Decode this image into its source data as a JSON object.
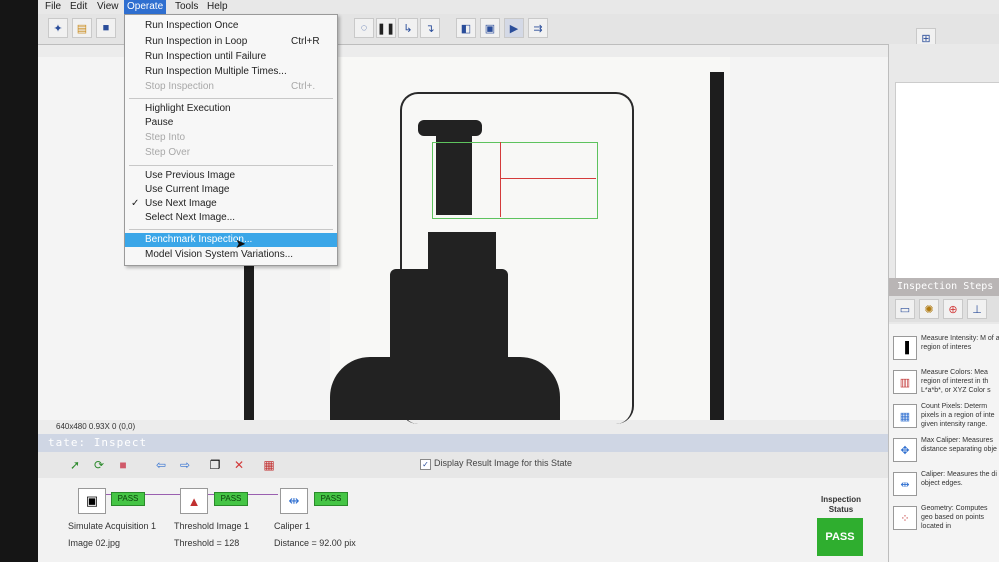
{
  "menubar": {
    "file": "File",
    "edit": "Edit",
    "view": "View",
    "operate": "Operate",
    "tools": "Tools",
    "help": "Help"
  },
  "operate_menu": {
    "run_once": "Run Inspection Once",
    "run_loop": "Run Inspection in Loop",
    "run_loop_shortcut": "Ctrl+R",
    "run_until_failure": "Run Inspection until Failure",
    "run_multiple": "Run Inspection Multiple Times...",
    "stop": "Stop Inspection",
    "stop_shortcut": "Ctrl+.",
    "highlight": "Highlight Execution",
    "pause": "Pause",
    "step_into": "Step Into",
    "step_over": "Step Over",
    "use_previous": "Use Previous Image",
    "use_current": "Use Current Image",
    "use_next": "Use Next Image",
    "select_next": "Select Next Image...",
    "benchmark": "Benchmark Inspection...",
    "model_variations": "Model Vision System Variations..."
  },
  "image_info": "640x480 0.93X 0    (0,0)",
  "state": "tate:  Inspect",
  "display_result": "Display Result Image for this State",
  "steps": [
    {
      "name": "Simulate Acquisition 1",
      "value": "Image 02.jpg",
      "status": "PASS"
    },
    {
      "name": "Threshold Image 1",
      "value": "Threshold = 128",
      "status": "PASS"
    },
    {
      "name": "Caliper 1",
      "value": "Distance = 92.00 pix",
      "status": "PASS"
    }
  ],
  "inspection_status": {
    "title": "Inspection Status",
    "value": "PASS"
  },
  "right_panel": {
    "header": "Inspection Steps",
    "items": [
      {
        "text": "Measure Intensity: M of a region of interes"
      },
      {
        "text": "Measure Colors: Mea region of interest in th L*a*b*, or XYZ Color s"
      },
      {
        "text": "Count Pixels: Determ pixels in a region of inte given intensity range."
      },
      {
        "text": "Max Caliper: Measures distance separating obje"
      },
      {
        "text": "Caliper: Measures the di object edges."
      },
      {
        "text": "Geometry: Computes geo based on points located in"
      }
    ]
  },
  "colors": {
    "pass": "#45c545",
    "highlight": "#3aa6e8",
    "roi": "#5ec35e",
    "caliper": "#d43b3b"
  }
}
